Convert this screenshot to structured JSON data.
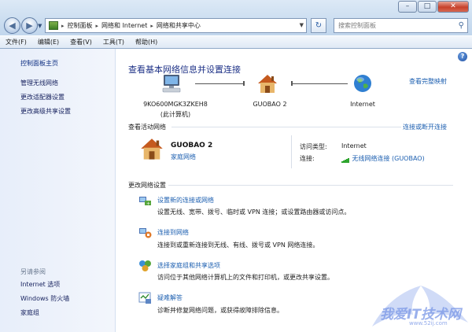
{
  "window": {
    "minimize": "–",
    "maximize": "□",
    "close": "✕"
  },
  "address": {
    "path": [
      "控制面板",
      "网络和 Internet",
      "网络和共享中心"
    ],
    "search_placeholder": "搜索控制面板"
  },
  "menu": [
    "文件(F)",
    "编辑(E)",
    "查看(V)",
    "工具(T)",
    "帮助(H)"
  ],
  "sidebar": {
    "home": "控制面板主页",
    "tasks": [
      "管理无线网络",
      "更改适配器设置",
      "更改高级共享设置"
    ],
    "see_also_title": "另请参阅",
    "see_also": [
      "Internet 选项",
      "Windows 防火墙",
      "家庭组"
    ]
  },
  "main": {
    "help": "?",
    "title": "查看基本网络信息并设置连接",
    "full_map": "查看完整映射",
    "nodes": [
      {
        "name": "9KO600MGK3ZKEH8",
        "sub": "(此计算机)",
        "icon": "computer-icon"
      },
      {
        "name": "GUOBAO  2",
        "sub": "",
        "icon": "house-icon"
      },
      {
        "name": "Internet",
        "sub": "",
        "icon": "globe-icon"
      }
    ],
    "active_title": "查看活动网络",
    "connect_disconnect": "连接或断开连接",
    "active_network": {
      "name": "GUOBAO  2",
      "type": "家庭网络",
      "access_type_label": "访问类型:",
      "access_type_value": "Internet",
      "connection_label": "连接:",
      "connection_value": "无线网络连接 (GUOBAO)"
    },
    "change_title": "更改网络设置",
    "tasks": [
      {
        "link": "设置新的连接或网络",
        "desc": "设置无线、宽带、拨号、临时或 VPN 连接；或设置路由器或访问点。"
      },
      {
        "link": "连接到网络",
        "desc": "连接到或重新连接到无线、有线、拨号或 VPN 网络连接。"
      },
      {
        "link": "选择家庭组和共享选项",
        "desc": "访问位于其他网络计算机上的文件和打印机，或更改共享设置。"
      },
      {
        "link": "疑难解答",
        "desc": "诊断并修复网络问题，或获得故障排除信息。"
      }
    ]
  },
  "watermark": {
    "text": "我爱IT技术网",
    "url": "www.52ij.com"
  }
}
